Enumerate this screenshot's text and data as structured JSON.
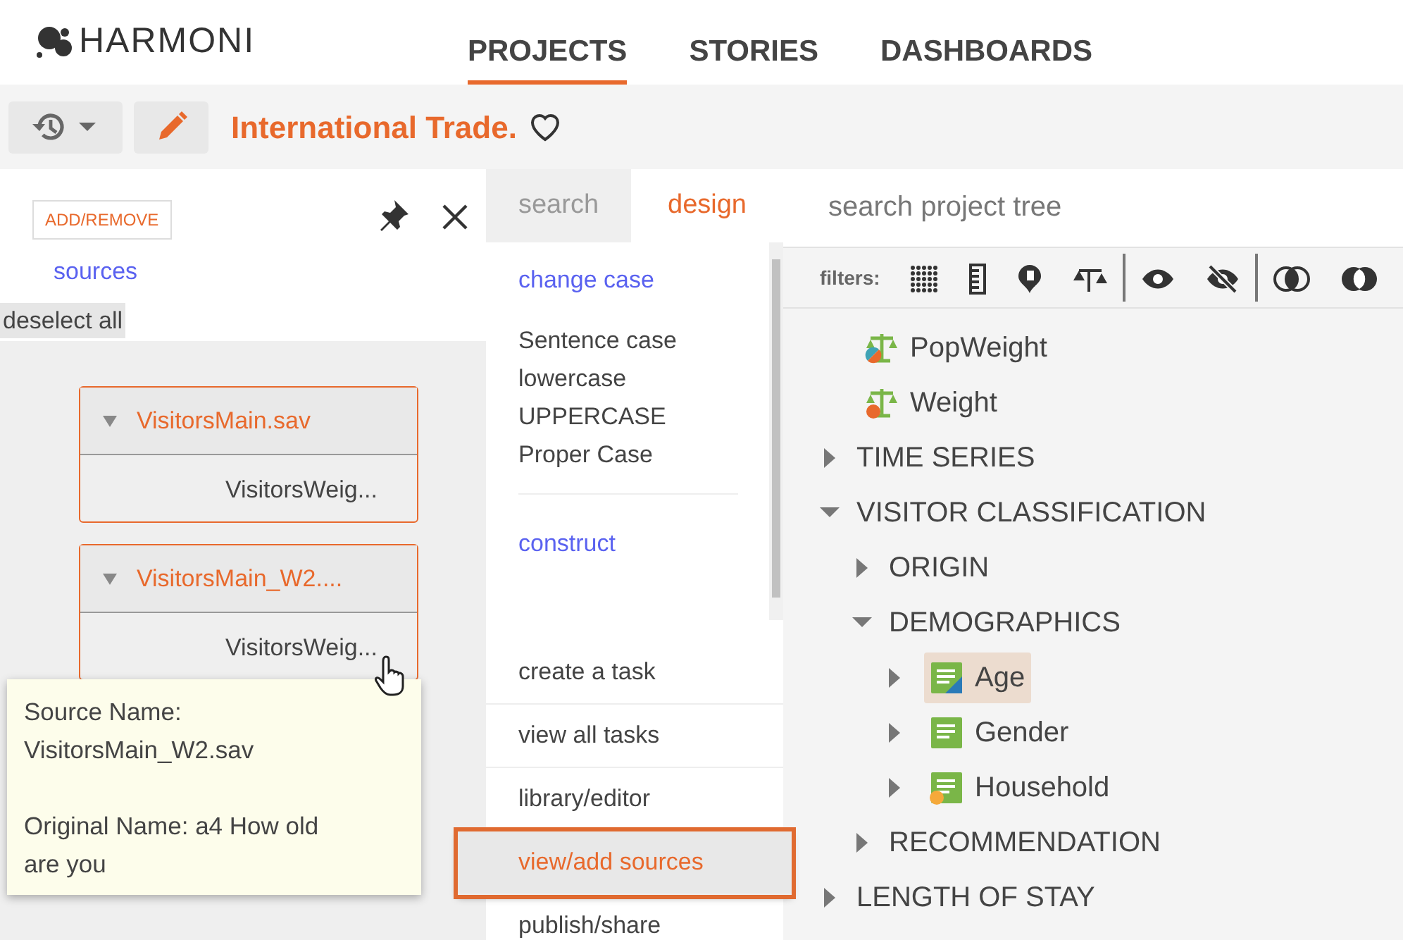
{
  "brand": {
    "name": "HARMONI"
  },
  "nav_tabs": [
    {
      "label": "PROJECTS",
      "selected": true
    },
    {
      "label": "STORIES",
      "selected": false
    },
    {
      "label": "DASHBOARDS",
      "selected": false
    }
  ],
  "project": {
    "title": "International Trade.",
    "favorite": false
  },
  "sources_panel": {
    "add_button": "ADD/REMOVE",
    "sources_link": "sources",
    "deselect_button": "deselect all",
    "sources": [
      {
        "name": "VisitorsMain.sav",
        "expanded": true,
        "items": [
          "VisitorsWeig..."
        ]
      },
      {
        "name": "VisitorsMain_W2....",
        "expanded": true,
        "items": [
          "VisitorsWeig..."
        ]
      }
    ]
  },
  "tooltip": {
    "source_label": "Source Name:",
    "source_name": "VisitorsMain_W2.sav",
    "original_name": "Original Name: a4 How old are you"
  },
  "design_panel": {
    "tabs": [
      {
        "label": "search",
        "selected": false
      },
      {
        "label": "design",
        "selected": true
      }
    ],
    "sections": [
      {
        "heading": "change case",
        "options": [
          "Sentence case",
          "lowercase",
          "UPPERCASE",
          "Proper Case"
        ]
      },
      {
        "heading": "construct"
      }
    ],
    "actions": [
      {
        "label": "create a task",
        "selected": false
      },
      {
        "label": "view all tasks",
        "selected": false
      },
      {
        "label": "library/editor",
        "selected": false
      },
      {
        "label": "view/add sources",
        "selected": true
      },
      {
        "label": "publish/share",
        "selected": false
      }
    ]
  },
  "project_tree": {
    "search": {
      "placeholder": "search project tree"
    },
    "filters_label": "filters:",
    "items": [
      {
        "label": "PopWeight",
        "kind": "weight-split",
        "selected": false
      },
      {
        "label": "Weight",
        "kind": "weight",
        "selected": false
      },
      {
        "label": "TIME SERIES",
        "kind": "folder",
        "expanded": false,
        "selected": false
      },
      {
        "label": "VISITOR CLASSIFICATION",
        "kind": "folder",
        "expanded": true,
        "selected": false,
        "children": [
          {
            "label": "ORIGIN",
            "kind": "folder",
            "expanded": false,
            "selected": false
          },
          {
            "label": "DEMOGRAPHICS",
            "kind": "folder",
            "expanded": true,
            "selected": false,
            "children": [
              {
                "label": "Age",
                "kind": "variable-edited",
                "expanded": false,
                "selected": true
              },
              {
                "label": "Gender",
                "kind": "variable",
                "expanded": false,
                "selected": false
              },
              {
                "label": "Household",
                "kind": "variable-flagged",
                "expanded": false,
                "selected": false
              }
            ]
          },
          {
            "label": "RECOMMENDATION",
            "kind": "folder",
            "expanded": false,
            "selected": false
          }
        ]
      },
      {
        "label": "LENGTH OF STAY",
        "kind": "folder",
        "expanded": false,
        "selected": false
      }
    ]
  }
}
